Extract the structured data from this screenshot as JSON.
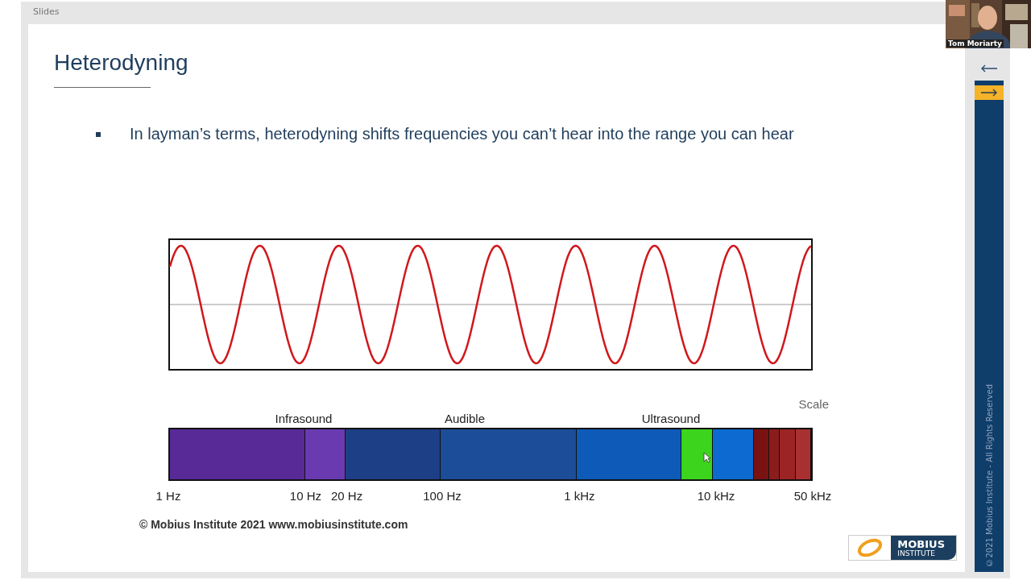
{
  "window": {
    "title": "Slides"
  },
  "slide": {
    "title": "Heterodyning",
    "bullet": "In layman’s terms, heterodyning shifts frequencies you can’t hear into the range you can hear",
    "spectrum": {
      "scale_label": "Scale",
      "bands": [
        "Infrasound",
        "Audible",
        "Ultrasound"
      ],
      "segments": [
        {
          "color": "#582a98"
        },
        {
          "color": "#6a3ab0"
        },
        {
          "color": "#1d3f85"
        },
        {
          "color": "#1c4d98"
        },
        {
          "color": "#0d5ab8"
        },
        {
          "color": "#3cd41c"
        },
        {
          "color": "#0c6ad0"
        },
        {
          "color": "#7a1212"
        },
        {
          "color": "#8c1c1c"
        },
        {
          "color": "#9c2424"
        },
        {
          "color": "#a83030"
        }
      ],
      "ticks": [
        "1 Hz",
        "10 Hz",
        "20 Hz",
        "100 Hz",
        "1 kHz",
        "10 kHz",
        "50 kHz"
      ]
    },
    "copyright": "© Mobius Institute 2021 www.mobiusinstitute.com",
    "logo": {
      "line1": "MOBIUS",
      "line2": "INSTITUTE"
    }
  },
  "sidebar": {
    "vertical_text": "©2021 Mobius Institute -  All Rights Reserved"
  },
  "video": {
    "name": "Tom Moriarty"
  }
}
